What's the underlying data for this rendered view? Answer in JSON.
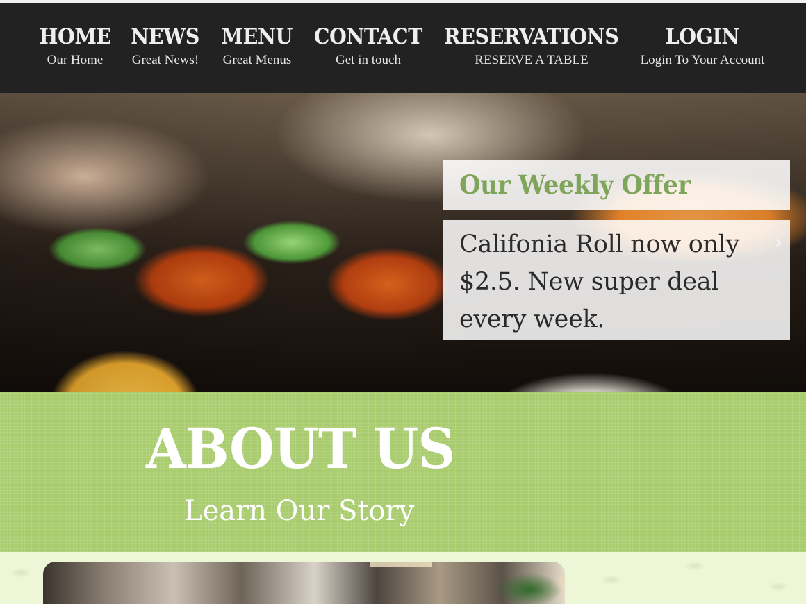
{
  "nav": {
    "items": [
      {
        "title": "HOME",
        "sub": "Our Home"
      },
      {
        "title": "NEWS",
        "sub": "Great News!"
      },
      {
        "title": "MENU",
        "sub": "Great Menus"
      },
      {
        "title": "CONTACT",
        "sub": "Get in touch"
      },
      {
        "title": "RESERVATIONS",
        "sub": "RESERVE A TABLE"
      },
      {
        "title": "LOGIN",
        "sub": "Login To Your Account"
      }
    ]
  },
  "hero": {
    "offer_title": "Our Weekly Offer",
    "offer_body": "Califonia Roll now only $2.5. New super deal every week.",
    "next_arrow": "›"
  },
  "about": {
    "title": "ABOUT US",
    "subtitle": "Learn Our Story"
  },
  "colors": {
    "nav_bg": "#222222",
    "accent_green": "#7fa55a",
    "about_bg": "#a8cc6e"
  }
}
